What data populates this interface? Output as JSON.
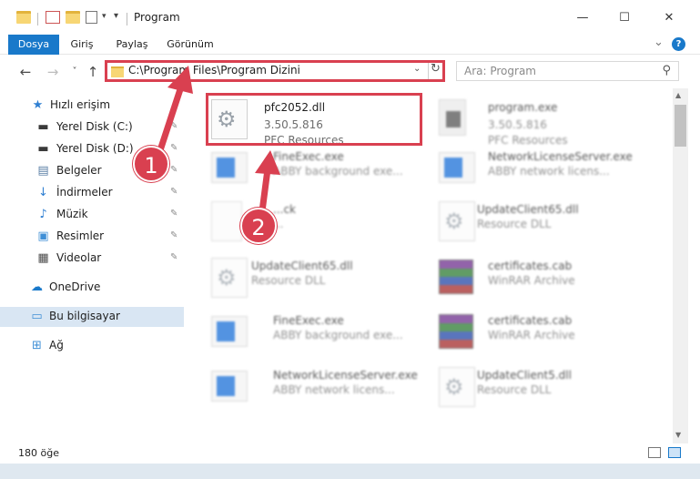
{
  "window": {
    "title": "Program",
    "minimize": "—",
    "maximize": "☐",
    "close": "✕"
  },
  "ribbon": {
    "tabs": [
      "Dosya",
      "Giriş",
      "Paylaş",
      "Görünüm"
    ],
    "collapse": "⌄",
    "help": "?"
  },
  "nav": {
    "back": "←",
    "forward": "→",
    "recent": "˅",
    "up": "↑",
    "address": "C:\\Program Files\\Program Dizini",
    "address_drop": "⌄",
    "refresh": "↻",
    "search_placeholder": "Ara: Program",
    "search_icon": "⚲"
  },
  "sidebar": {
    "items": [
      {
        "label": "Hızlı erişim",
        "icon": "★",
        "color": "#2f7fd2",
        "pinned": false
      },
      {
        "label": "Yerel Disk (C:)",
        "icon": "▬",
        "color": "#3a3a3a",
        "pinned": true
      },
      {
        "label": "Yerel Disk (D:)",
        "icon": "▬",
        "color": "#3a3a3a",
        "pinned": true
      },
      {
        "label": "Belgeler",
        "icon": "▤",
        "color": "#5b7fa6",
        "pinned": true
      },
      {
        "label": "İndirmeler",
        "icon": "↓",
        "color": "#2f7fd2",
        "pinned": true
      },
      {
        "label": "Müzik",
        "icon": "♪",
        "color": "#2f7fd2",
        "pinned": true
      },
      {
        "label": "Resimler",
        "icon": "▣",
        "color": "#3f8fd6",
        "pinned": true
      },
      {
        "label": "Videolar",
        "icon": "▦",
        "color": "#4b4b4b",
        "pinned": true
      },
      {
        "label": "OneDrive",
        "icon": "☁",
        "color": "#1979ca",
        "pinned": false
      },
      {
        "label": "Bu bilgisayar",
        "icon": "▭",
        "color": "#3f8fd6",
        "pinned": false
      },
      {
        "label": "Ağ",
        "icon": "⊞",
        "color": "#3f8fd6",
        "pinned": false
      }
    ],
    "pin_glyph": "📌"
  },
  "files": [
    {
      "name": "pfc2052.dll",
      "line1": "3.50.5.816",
      "line2": "PFC Resources",
      "kind": "dll",
      "blurred": false
    },
    {
      "name": "program.exe",
      "line1": "3.50.5.816",
      "line2": "PFC Resources",
      "kind": "exe2",
      "blurred": true
    },
    {
      "name": "FineExec.exe",
      "line1": "ABBY background exe...",
      "line2": "",
      "kind": "exe",
      "blurred": true
    },
    {
      "name": "NetworkLicenseServer.exe",
      "line1": "ABBY network licens...",
      "line2": "",
      "kind": "exe",
      "blurred": true
    },
    {
      "name": "...ck",
      "line1": "...",
      "line2": "",
      "kind": "doc",
      "blurred": true
    },
    {
      "name": "UpdateClient65.dll",
      "line1": "Resource DLL",
      "line2": "",
      "kind": "dll",
      "blurred": true
    },
    {
      "name": "UpdateClient65.dll",
      "line1": "Resource DLL",
      "line2": "",
      "kind": "dll",
      "blurred": true
    },
    {
      "name": "certificates.cab",
      "line1": "WinRAR Archive",
      "line2": "",
      "kind": "cab",
      "blurred": true
    },
    {
      "name": "FineExec.exe",
      "line1": "ABBY background exe...",
      "line2": "",
      "kind": "exe",
      "blurred": true
    },
    {
      "name": "certificates.cab",
      "line1": "WinRAR Archive",
      "line2": "",
      "kind": "cab",
      "blurred": true
    },
    {
      "name": "NetworkLicenseServer.exe",
      "line1": "ABBY network licens...",
      "line2": "",
      "kind": "exe",
      "blurred": true
    },
    {
      "name": "UpdateClient5.dll",
      "line1": "Resource DLL",
      "line2": "",
      "kind": "dll",
      "blurred": true
    }
  ],
  "callouts": [
    "1",
    "2"
  ],
  "accent": "#d94050",
  "status": {
    "count": "180 öğe"
  }
}
